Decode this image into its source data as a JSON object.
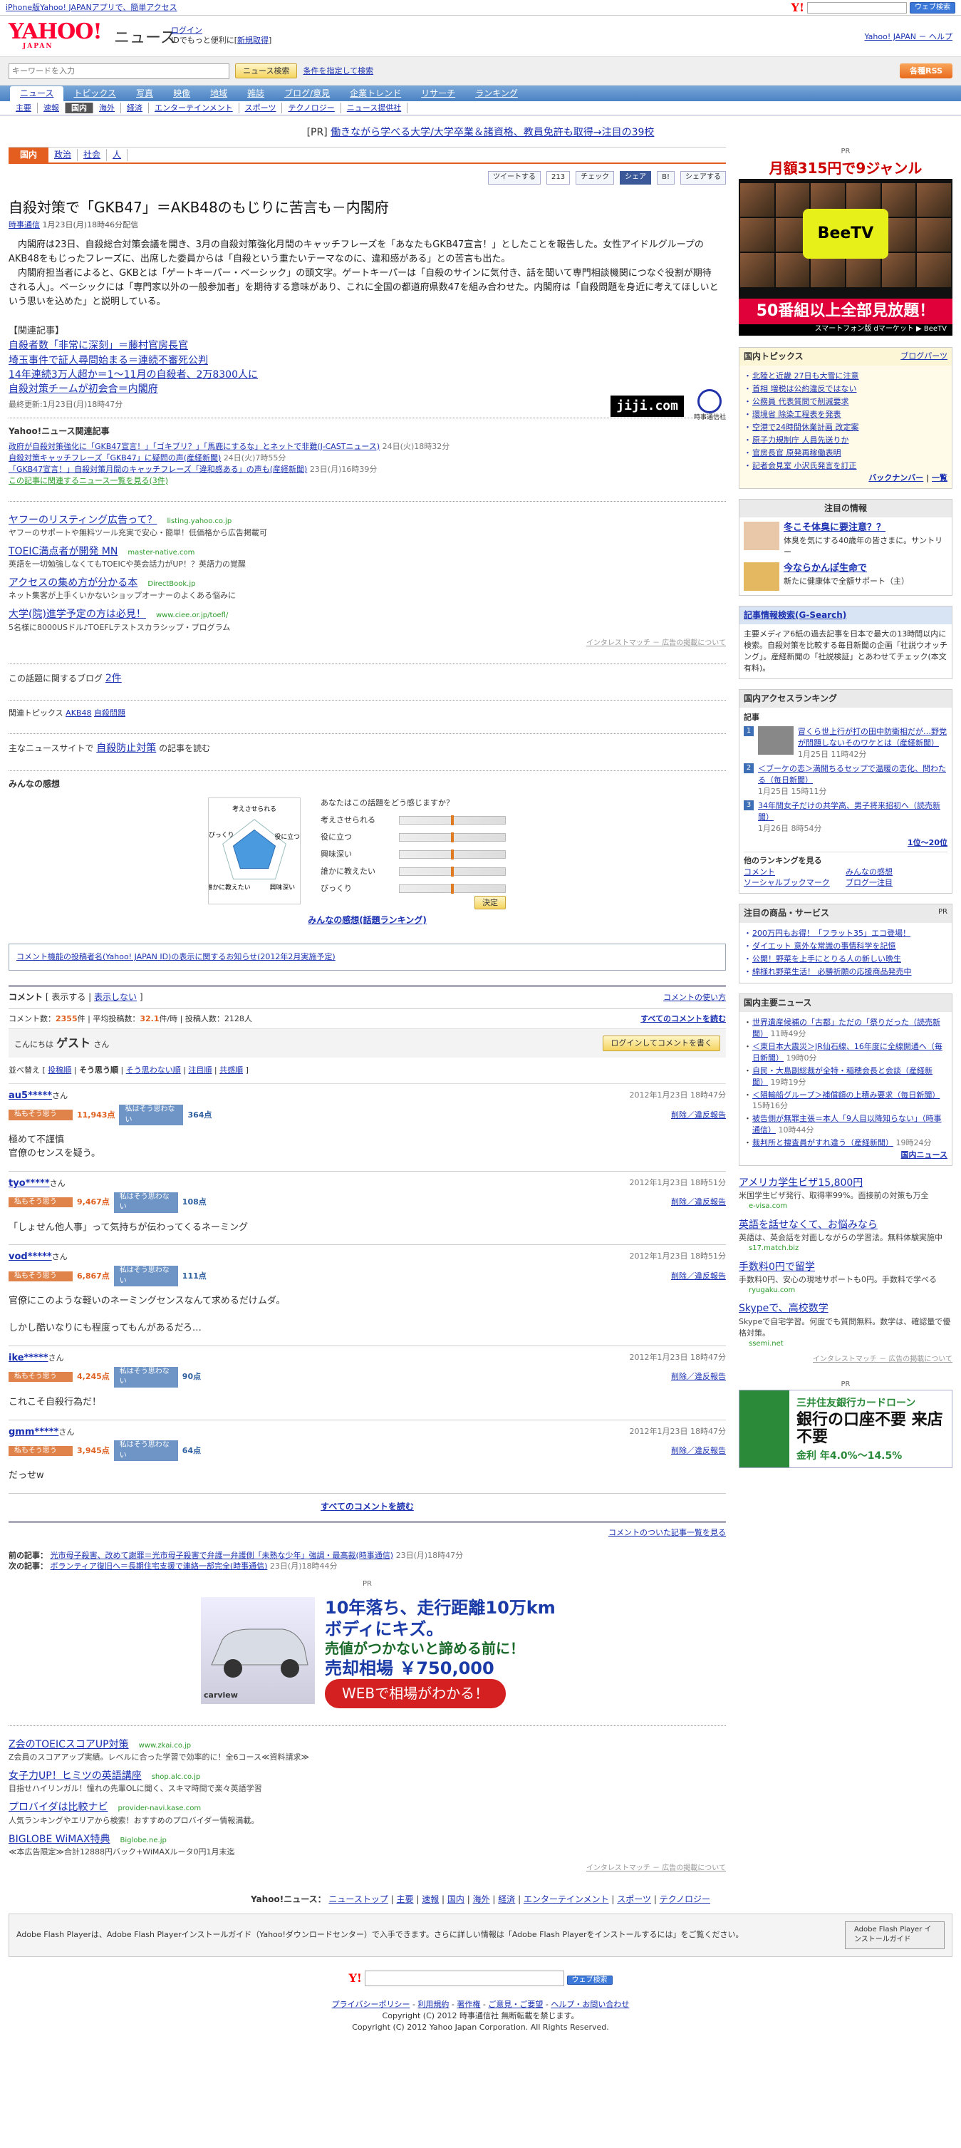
{
  "topbar": {
    "promo": "iPhone版Yahoo! JAPANアプリで、簡単アクセス",
    "search_btn": "ウェブ検索"
  },
  "header": {
    "logo": "YAHOO!",
    "logo_sub": "JAPAN",
    "section": "ニュース",
    "login": "ログイン",
    "login_note": "IDでもっと便利に[",
    "register": "新規取得",
    "login_note_end": "]",
    "links": "Yahoo! JAPAN － ヘルプ"
  },
  "search": {
    "placeholder": "キーワードを入力",
    "btn": "ニュース検索",
    "cond": "条件を指定して検索",
    "rss": "各種RSS"
  },
  "nav_main": [
    "ニュース",
    "トピックス",
    "写真",
    "映像",
    "地域",
    "雑誌",
    "ブログ/意見",
    "企業トレンド",
    "リサーチ",
    "ランキング"
  ],
  "nav_sub": [
    "主要",
    "速報",
    "国内",
    "海外",
    "経済",
    "エンターテインメント",
    "スポーツ",
    "テクノロジー",
    "ニュース提供社"
  ],
  "pr_line": {
    "pr": "[PR]",
    "text": "働きながら学べる大学/大学卒業＆諸資格、教員免許も取得→注目の39校"
  },
  "catbar": {
    "cat": "国内",
    "subs": [
      "政治",
      "社会",
      "人"
    ]
  },
  "share": {
    "tweet": "ツイートする",
    "tweet_count": "213",
    "check": "チェック",
    "fb": "シェア",
    "b": "B!",
    "mixi": "シェアする"
  },
  "article": {
    "title": "自殺対策で「GKB47」＝AKB48のもじりに苦言も－内閣府",
    "source": "時事通信",
    "date": "1月23日(月)18時46分配信",
    "p1": "　内閣府は23日、自殺総合対策会議を開き、3月の自殺対策強化月間のキャッチフレーズを「あなたもGKB47宣言！」としたことを報告した。女性アイドルグループのAKB48をもじったフレーズに、出席した委員からは「自殺という重たいテーマなのに、違和感がある」との苦言も出た。",
    "p2": "　内閣府担当者によると、GKBとは「ゲートキーパー・ベーシック」の頭文字。ゲートキーパーは「自殺のサインに気付き、話を聞いて専門相談機関につなぐ役割が期待される人」。ベーシックには「専門家以外の一般参加者」を期待する意味があり、これに全国の都道府県数47を組み合わせた。内閣府は「自殺問題を身近に考えてほしいという思いを込めた」と説明している。",
    "related_title": "【関連記事】",
    "related": [
      "自殺者数「非常に深刻」＝藤村官房長官",
      "埼玉事件で証人尋問始まる＝連続不審死公判",
      "14年連続3万人超か＝1～11月の自殺者、2万8300人に",
      "自殺対策チームが初会合＝内閣府"
    ],
    "updated": "最終更新:1月23日(月)18時47分",
    "jiji": "jiji.com",
    "jiji_sub": "時事通信社"
  },
  "related_news": {
    "title": "Yahoo!ニュース関連記事",
    "items": [
      {
        "text": "政府が自殺対策強化に「GKB47宣言！」「ゴキブリ？」「馬鹿にするな」とネットで非難(J-CASTニュース)",
        "date": "24日(火)18時32分"
      },
      {
        "text": "自殺対策キャッチフレーズ「GKB47」に疑問の声(産経新聞)",
        "date": "24日(火)7時55分"
      },
      {
        "text": "「GKB47宣言！」自殺対策月間のキャッチフレーズ「違和感ある」の声も(産経新聞)",
        "date": "23日(月)16時39分"
      }
    ],
    "more": "この記事に関連するニュース一覧を見る(3件)"
  },
  "ads": [
    {
      "t": "ヤフーのリスティング広告って？",
      "u": "listing.yahoo.co.jp",
      "d": "ヤフーのサポートや無料ツール充実で安心・簡単！低価格から広告掲載可"
    },
    {
      "t": "TOEIC満点者が開発 MN",
      "u": "master-native.com",
      "d": "英語を一切勉強しなくてもTOEICや英会話力がUP！？英語力の覚醒"
    },
    {
      "t": "アクセスの集め方が分かる本",
      "u": "DirectBook.jp",
      "d": "ネット集客が上手くいかないショップオーナーのよくある悩みに"
    },
    {
      "t": "大学(院)進学予定の方は必見！",
      "u": "www.ciee.or.jp/toefl/",
      "d": "5名様に8000USドル♪TOEFLテストスカラシップ・プログラム"
    }
  ],
  "inter": "インタレストマッチ － 広告の掲載について",
  "blog": {
    "label": "この話題に関するブログ",
    "count": "2件"
  },
  "topics": {
    "label": "関連トピックス",
    "items": [
      "AKB48",
      "自殺問題"
    ]
  },
  "major": {
    "pre": "主なニュースサイトで",
    "kw": "自殺防止対策",
    "post": "の記事を読む"
  },
  "kansou": {
    "title": "みんなの感想",
    "question": "あなたはこの話題をどう感じますか？",
    "axes": [
      "考えさせられる",
      "役に立つ",
      "興味深い",
      "誰かに教えたい",
      "びっくり"
    ],
    "decide": "決定",
    "ranking": "みんなの感想(話題ランキング)"
  },
  "notice": "コメント機能の投稿者名(Yahoo! JAPAN ID)の表示に関するお知らせ(2012年2月実施予定)",
  "comments_head": {
    "title": "コメント",
    "show": "表示する",
    "hide": "表示しない",
    "howto": "コメントの使い方"
  },
  "stats": {
    "count_label": "コメント数：",
    "count": "2355",
    "count_unit": "件",
    "avg_label": "平均投稿数：",
    "avg": "32.1",
    "avg_unit": "件/時",
    "users_label": "投稿人数：",
    "users": "2128人",
    "all": "すべてのコメントを読む"
  },
  "guest": {
    "hello": "こんにちは",
    "name": "ゲスト",
    "san": "さん",
    "login_btn": "ログインしてコメントを書く"
  },
  "sort": {
    "label": "並べ替え",
    "opts": [
      "投稿順",
      "そう思う順",
      "そう思わない順",
      "注目順",
      "共感順"
    ]
  },
  "comments": [
    {
      "user": "au5*****",
      "san": "さん",
      "date": "2012年1月23日 18時47分",
      "yes": "11,943点",
      "no": "364点",
      "text": "極めて不謹慎\n官僚のセンスを疑う。"
    },
    {
      "user": "tyo*****",
      "san": "さん",
      "date": "2012年1月23日 18時51分",
      "yes": "9,467点",
      "no": "108点",
      "text": "「しょせん他人事」って気持ちが伝わってくるネーミング"
    },
    {
      "user": "vod*****",
      "san": "さん",
      "date": "2012年1月23日 18時51分",
      "yes": "6,867点",
      "no": "111点",
      "text": "官僚にこのような軽いのネーミングセンスなんて求めるだけムダ。\n\nしかし酷いなりにも程度ってもんがあるだろ…"
    },
    {
      "user": "ike*****",
      "san": "さん",
      "date": "2012年1月23日 18時47分",
      "yes": "4,245点",
      "no": "90点",
      "text": "これこそ自殺行為だ！"
    },
    {
      "user": "gmm*****",
      "san": "さん",
      "date": "2012年1月23日 18時47分",
      "yes": "3,945点",
      "no": "64点",
      "text": "だっせw"
    }
  ],
  "vote_labels": {
    "yes": "私もそう思う",
    "no": "私はそう思わない",
    "report": "削除／違反報告"
  },
  "all_comments": "すべてのコメントを読む",
  "comment_list": "コメントのついた記事一覧を見る",
  "prevnext": {
    "prev_label": "前の記事：",
    "prev": "光市母子殺害、改めて謝罪＝光市母子殺害で弁護一弁護側「未熟な少年」強調・最高裁(時事通信)",
    "prev_date": "23日(月)18時47分",
    "next_label": "次の記事：",
    "next": "ボランティア復旧へ＝長期住宅支援で連絡一部完全(時事通信)",
    "next_date": "23日(月)18時44分"
  },
  "carad": {
    "pr": "PR",
    "l1": "10年落ち、走行距離10万km",
    "l2": "ボディにキズ。",
    "l3": "売値がつかないと諦める前に！",
    "price": "売却相場 ￥750,000",
    "btn": "WEBで相場がわかる！",
    "brand": "carview"
  },
  "ads2": [
    {
      "t": "Z会のTOEICスコアUP対策",
      "u": "www.zkai.co.jp",
      "d": "Z会員のスコアアップ実績。レベルに合った学習で効率的に！全6コース≪資料請求≫"
    },
    {
      "t": "女子力UP！ヒミツの英語講座",
      "u": "shop.alc.co.jp",
      "d": "目指せハイリンガル！憧れの先輩OLに聞く、スキマ時間で楽々英語学習"
    },
    {
      "t": "プロバイダは比較ナビ",
      "u": "provider-navi.kase.com",
      "d": "人気ランキングやエリアから検索！おすすめのプロバイダー情報満載。"
    },
    {
      "t": "BIGLOBE WiMAX特典",
      "u": "Biglobe.ne.jp",
      "d": "≪本広告限定≫合計12888円バック+WiMAXルータ0円1月末迄"
    }
  ],
  "footer_nav": {
    "label": "Yahoo!ニュース：",
    "items": [
      "ニューストップ",
      "主要",
      "速報",
      "国内",
      "海外",
      "経済",
      "エンターテインメント",
      "スポーツ",
      "テクノロジー"
    ]
  },
  "flash": {
    "text": "Adobe Flash Playerは、Adobe Flash Playerインストールガイド（Yahoo!ダウンロードセンター）で入手できます。さらに詳しい情報は「Adobe Flash Playerをインストールするには」をご覧ください。",
    "btn": "Adobe Flash Player インストールガイド"
  },
  "bottom": {
    "btn": "ウェブ検索",
    "links": [
      "プライバシーポリシー",
      "利用規約",
      "著作権",
      "ご意見・ご要望",
      "ヘルプ・お問い合わせ"
    ],
    "c1": "Copyright (C) 2012 時事通信社 無断転載を禁じます。",
    "c2": "Copyright (C) 2012 Yahoo Japan Corporation. All Rights Reserved."
  },
  "side": {
    "pr": "PR",
    "beetv_top": "月額315円で9ジャンル",
    "beetv_logo": "BeeTV",
    "beetv_btm": "50番組以上全部見放題！",
    "beetv_foot": "スマートフォン版 dマーケット ▶ BeeTV",
    "topics_title": "国内トピックス",
    "topics_blog": "ブログパーツ",
    "topics": [
      "北陸と近畿 27日も大雪に注意",
      "首相 増税は公約違反ではない",
      "公務員 代表質問で削減要求",
      "環境省 除染工程表を発表",
      "空港で24時間休業計画 改定案",
      "原子力規制庁 人員先送りか",
      "官房長官 原発再稼働表明",
      "記者会見室 小沢氏発言を訂正"
    ],
    "topics_more": "バックナンバー",
    "topics_list": "一覧",
    "chumoku_title": "注目の情報",
    "chumoku": [
      {
        "t": "冬こそ体臭に要注意？？",
        "d": "体臭を気にする40歳年の皆さまに。サントリー"
      },
      {
        "t": "今ならかんぽ生命で",
        "d": "新たに健康体で全額サポート（主）"
      }
    ],
    "gsearch_title": "記事情報検索(G-Search)",
    "gsearch_text": "主要メディア6紙の過去記事を日本で最大の13時間以内に検索。自殺対策を比較する毎日新聞の企画「社説ウオッチング」。産経新聞の「社説検証」とあわせてチェック(本文有料)。",
    "access_title": "国内アクセスランキング",
    "access_sub": "記事",
    "access": [
      {
        "t": "冒くら世上行が打の田中防衛相だが…野党が問題しないそのワケとは（産経新聞）",
        "d": "1月25日 11時42分"
      },
      {
        "t": "＜ブーケの恋＞満開ちるセップで温暖の恋化、問わたる（毎日新聞）",
        "d": "1月25日 15時11分"
      },
      {
        "t": "34年間女子だけの共学高、男子将来招初へ（読売新聞）",
        "d": "1月26日 8時54分"
      }
    ],
    "access_more": "1位〜20位",
    "other_title": "他のランキングを見る",
    "other": [
      "コメント",
      "みんなの感想",
      "ソーシャルブックマーク",
      "ブログ一注目"
    ],
    "items_title": "注目の商品・サービス",
    "items": [
      "200万円もお得！「フラット35」エコ登場！",
      "ダイエット 意外な常識の事情科学を記憶",
      "公開！野菜を上手にとりる人の新しい晩生",
      "綿様れ野菜生活！ 必勝祈願の応援商品発売中"
    ],
    "shuyou_title": "国内主要ニュース",
    "shuyou": [
      {
        "t": "世界遺産候補の「古都」ただの「祭りだった（読売新聞）",
        "d": "11時49分"
      },
      {
        "t": "＜東日本大震災＞JR仙石線、16年度に全線開通へ（毎日新聞）",
        "d": "19時0分"
      },
      {
        "t": "自民・大島副総裁が全特・稲穂会長と会談（産経新聞）",
        "d": "19時19分"
      },
      {
        "t": "＜隕輸船グループ＞補償額の上積み要求（毎日新聞）",
        "d": "15時16分"
      },
      {
        "t": "被告側が無罪主張＝本人「9人目以降知らない」（時事通信）",
        "d": "10時44分"
      },
      {
        "t": "裁判所と捜査員がすれ違う（産経新聞）",
        "d": "19時24分"
      }
    ],
    "shuyou_more": "国内ニュース",
    "sads": [
      {
        "t": "アメリカ学生ビザ15,800円",
        "d": "米国学生ビザ発行、取得率99%。面接前の対策も万全",
        "u": "e-visa.com"
      },
      {
        "t": "英語を話せなくて、お悩みなら",
        "d": "英語は、英会話を対面しながらの学習法。無料体験実施中",
        "u": "s17.match.biz"
      },
      {
        "t": "手数料0円で留学",
        "d": "手数料0円、安心の現地サポートも0円。手数料で学べる",
        "u": "ryugaku.com"
      },
      {
        "t": "Skypeで、高校数学",
        "d": "Skypeで自宅学習。何度でも質問無料。数学は、確認量で優格対策。",
        "u": "ssemi.net"
      }
    ],
    "sinter": "インタレストマッチ － 広告の掲載について",
    "mitsui_t": "三井住友銀行カードローン",
    "mitsui_t2": "銀行の口座不要 来店不要",
    "mitsui_t3": "金利 年4.0%～14.5%"
  }
}
